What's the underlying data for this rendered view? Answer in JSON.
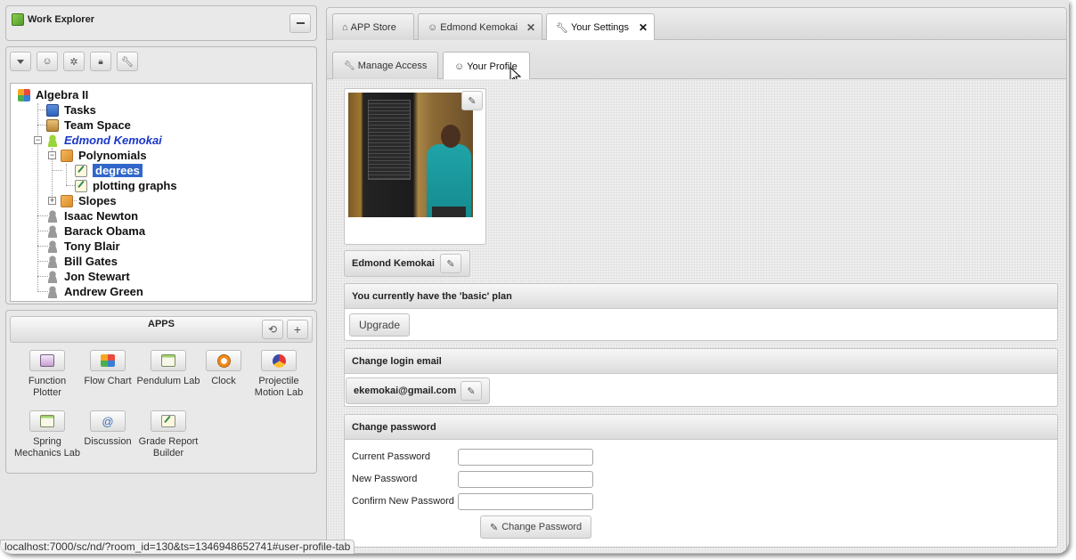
{
  "work_explorer": {
    "title": "Work Explorer"
  },
  "tree": {
    "root": "Algebra II",
    "items": {
      "tasks": "Tasks",
      "team_space": "Team Space",
      "edmond": "Edmond Kemokai",
      "polynomials": "Polynomials",
      "degrees": "degrees",
      "plotting_graphs": "plotting graphs",
      "slopes": "Slopes",
      "isaac": "Isaac Newton",
      "barack": "Barack Obama",
      "tony": "Tony Blair",
      "bill": "Bill Gates",
      "jon": "Jon Stewart",
      "andrew": "Andrew Green"
    }
  },
  "apps": {
    "title": "APPS",
    "tiles": [
      {
        "label": "Function Plotter",
        "icon": "function-plotter-icon"
      },
      {
        "label": "Flow Chart",
        "icon": "flow-chart-icon"
      },
      {
        "label": "Pendulum Lab",
        "icon": "pendulum-lab-icon"
      },
      {
        "label": "Clock",
        "icon": "clock-icon"
      },
      {
        "label": "Projectile Motion Lab",
        "icon": "projectile-motion-icon"
      },
      {
        "label": "Spring Mechanics Lab",
        "icon": "spring-mechanics-icon"
      },
      {
        "label": "Discussion",
        "icon": "discussion-icon"
      },
      {
        "label": "Grade Report Builder",
        "icon": "grade-report-icon"
      }
    ]
  },
  "top_tabs": {
    "app_store": "APP Store",
    "edmond": "Edmond Kemokai",
    "settings": "Your Settings"
  },
  "sub_tabs": {
    "manage_access": "Manage Access",
    "profile": "Your Profile"
  },
  "profile": {
    "name": "Edmond Kemokai",
    "plan_text": "You currently have the 'basic' plan",
    "upgrade_label": "Upgrade",
    "email_header": "Change login email",
    "email": "ekemokai@gmail.com",
    "password_header": "Change password",
    "current_password_label": "Current Password",
    "new_password_label": "New Password",
    "confirm_password_label": "Confirm New Password",
    "change_password_label": "Change Password"
  },
  "status_bar": {
    "url": "localhost:7000/sc/nd/?room_id=130&ts=1346948652741#user-profile-tab"
  },
  "colors": {
    "selection": "#3067c9",
    "current_user": "#1a37c8",
    "window_bg": "#e6e6e6"
  }
}
